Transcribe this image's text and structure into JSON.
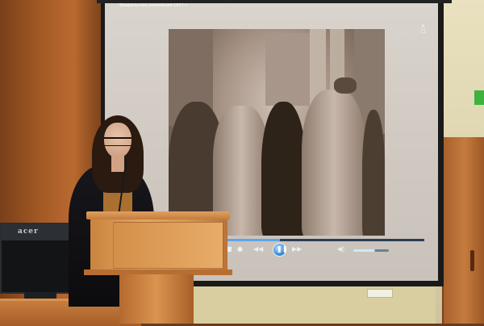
{
  "video": {
    "title": "Февральская революция 1917 г.",
    "scene_colors": {
      "sepia_light": "#cdbfb4",
      "sepia_dark": "#3e3128"
    }
  },
  "player": {
    "progress": 0.28,
    "volume": 0.6,
    "controls": [
      {
        "name": "stop-icon",
        "glyph": "■"
      },
      {
        "name": "record-icon",
        "glyph": "●"
      },
      {
        "name": "rewind-icon",
        "glyph": "◀◀"
      },
      {
        "name": "play-pause-icon",
        "glyph": "❚❚"
      },
      {
        "name": "fast-forward-icon",
        "glyph": "▶▶"
      },
      {
        "name": "volume-icon",
        "glyph": "◀)"
      }
    ],
    "accent_color": "#3d8ed8"
  },
  "monitor": {
    "brand": "acer"
  },
  "window_icons": {
    "close": "×",
    "maximize": "□"
  }
}
